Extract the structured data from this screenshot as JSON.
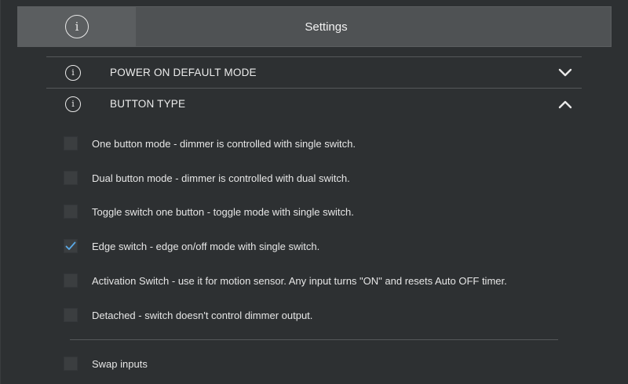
{
  "header": {
    "title": "Settings",
    "icon": "info-icon"
  },
  "sections": [
    {
      "label": "POWER ON DEFAULT MODE",
      "icon": "info-icon",
      "state": "collapsed"
    },
    {
      "label": "BUTTON TYPE",
      "icon": "info-icon",
      "state": "expanded"
    }
  ],
  "button_type_options": [
    {
      "label": "One button mode - dimmer is controlled with single switch.",
      "checked": false
    },
    {
      "label": "Dual button mode - dimmer is controlled with dual switch.",
      "checked": false
    },
    {
      "label": "Toggle switch one button - toggle mode with single switch.",
      "checked": false
    },
    {
      "label": "Edge switch - edge on/off mode with single switch.",
      "checked": true
    },
    {
      "label": "Activation Switch - use it for motion sensor. Any input turns \"ON\" and resets Auto OFF timer.",
      "checked": false
    },
    {
      "label": "Detached - switch doesn't control dimmer output.",
      "checked": false
    }
  ],
  "swap_inputs": {
    "label": "Swap inputs",
    "checked": false
  },
  "colors": {
    "background": "#2d3032",
    "header": "#4f5254",
    "accent_check": "#5aa9e6"
  }
}
